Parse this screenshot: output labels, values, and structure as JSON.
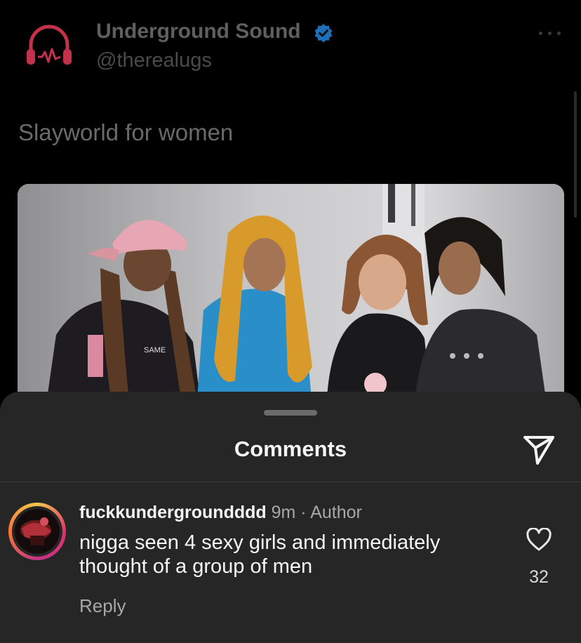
{
  "post": {
    "account_name": "Underground Sound",
    "account_handle": "@therealugs",
    "verified": true,
    "text": "Slayworld for women",
    "logo_icon": "headphones-pulse-logo"
  },
  "comments_sheet": {
    "title": "Comments",
    "share_icon": "send-icon",
    "comments": [
      {
        "username": "fuckkundergroundddd",
        "time": "9m",
        "separator": " · ",
        "tag": "Author",
        "text": "nigga seen 4 sexy girls and immediately thought of a group of men",
        "reply_label": "Reply",
        "like_count": "32"
      }
    ]
  },
  "colors": {
    "background": "#000000",
    "sheet": "#262626",
    "verified_blue": "#0095f6",
    "logo_red": "#c4314b"
  }
}
